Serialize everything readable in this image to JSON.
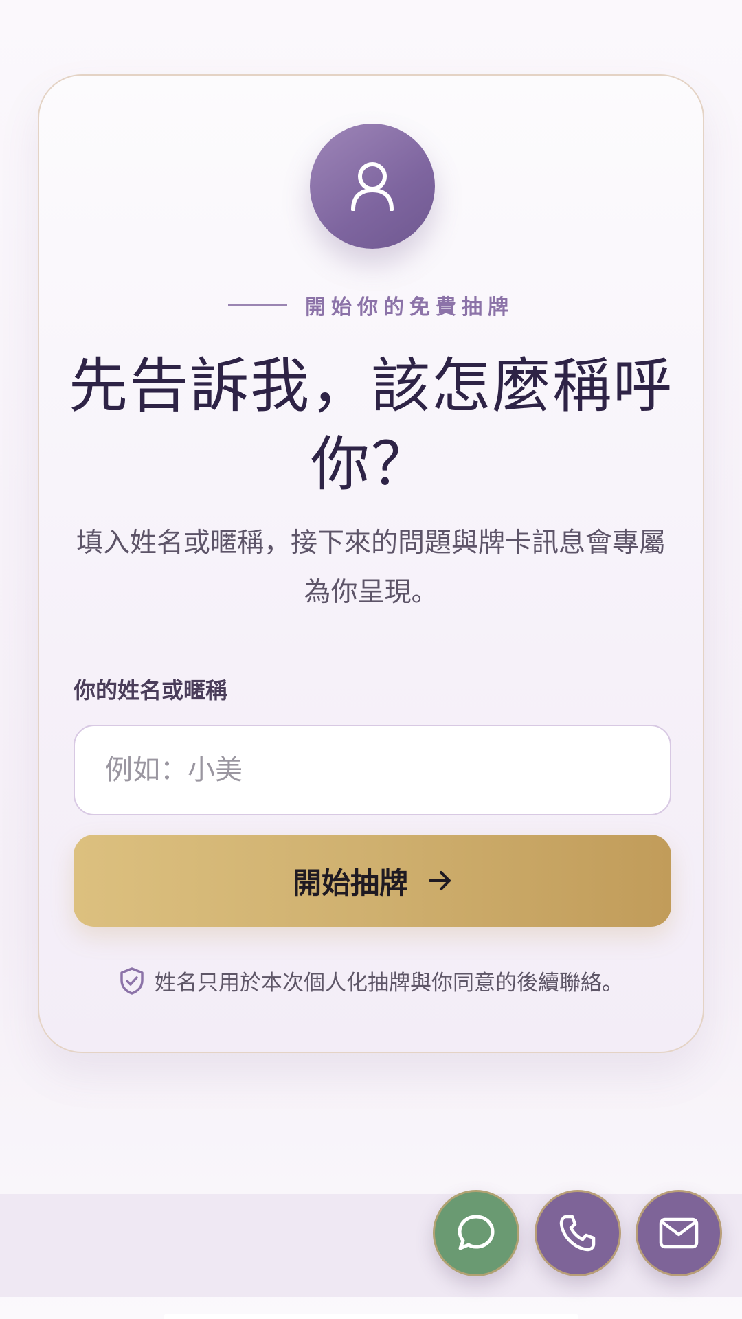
{
  "card": {
    "eyebrow": "開始你的免費抽牌",
    "title": "先告訴我，該怎麼稱呼你？",
    "subtitle": "填入姓名或暱稱，接下來的問題與牌卡訊息會專屬為你呈現。",
    "name_label": "你的姓名或暱稱",
    "name_placeholder": "例如：小美",
    "name_value": "",
    "submit_label": "開始抽牌",
    "privacy_note": "姓名只用於本次個人化抽牌與你同意的後續聯絡。"
  },
  "icons": {
    "avatar": "user-icon",
    "submit": "arrow-right-icon",
    "privacy": "shield-check-icon",
    "chat": "chat-bubble-icon",
    "phone": "phone-icon",
    "mail": "mail-icon"
  },
  "colors": {
    "accent_purple": "#7e6498",
    "gold": "#cfb06f",
    "chat_green": "#6a9a72",
    "title_text": "#2e2346"
  }
}
